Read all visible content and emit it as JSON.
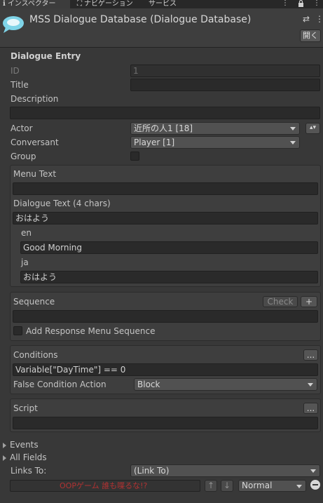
{
  "tabs": {
    "inspector": "インスペクター",
    "navigation": "ナビゲーション",
    "services": "サービス",
    "menu_glyph": "⋮",
    "lock_glyph": "🔒",
    "more_glyph": "⋮"
  },
  "header": {
    "title": "MSS Dialogue Database (Dialogue Database)",
    "open_label": "開く",
    "settings_glyph": "⇄",
    "more_glyph": "⋮"
  },
  "entry": {
    "section_title": "Dialogue Entry",
    "id_label": "ID",
    "id_value": "1",
    "title_label": "Title",
    "title_value": "",
    "description_label": "Description",
    "description_value": "",
    "actor_label": "Actor",
    "actor_value": "近所の人1 [18]",
    "conversant_label": "Conversant",
    "conversant_value": "Player [1]",
    "group_label": "Group",
    "spinner_glyph": "▴▾"
  },
  "text_box": {
    "menu_text_label": "Menu Text",
    "menu_text_value": "",
    "dialogue_text_label": "Dialogue Text (4 chars)",
    "dialogue_text_value": "おはよう",
    "lang_en": "en",
    "lang_en_value": "Good Morning",
    "lang_ja": "ja",
    "lang_ja_value": "おはよう"
  },
  "sequence_box": {
    "label": "Sequence",
    "check_label": "Check",
    "plus_label": "+",
    "value": "",
    "add_response_label": "Add Response Menu Sequence"
  },
  "conditions_box": {
    "label": "Conditions",
    "ellipsis_label": "...",
    "value": "Variable[\"DayTime\"] == 0",
    "false_action_label": "False Condition Action",
    "false_action_value": "Block"
  },
  "script_box": {
    "label": "Script",
    "ellipsis_label": "...",
    "value": ""
  },
  "foldouts": {
    "events": "Events",
    "all_fields": "All Fields"
  },
  "links": {
    "label": "Links To:",
    "value": "(Link To)",
    "link_text": "OOPゲーム 誰も喋るな!?",
    "up_glyph": "↑",
    "down_glyph": "↓",
    "priority_value": "Normal"
  }
}
